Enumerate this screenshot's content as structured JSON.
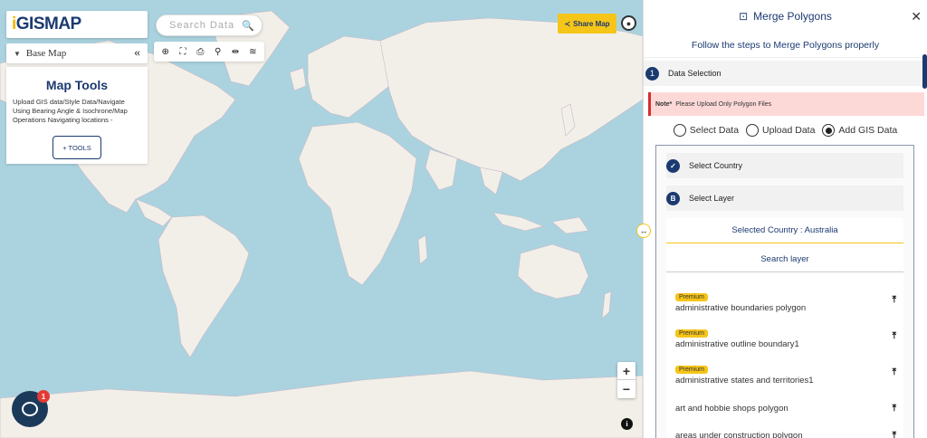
{
  "app": {
    "logo": "GISMAP",
    "basemap_label": "Base Map",
    "tools_title": "Map Tools",
    "tools_desc": "Upload GIS data/Style Data/Navigate Using Bearing Angle & Isochrone/Map Operations Navigating locations -",
    "tools_button": "+ TOOLS",
    "search_placeholder": "Search Data",
    "share_label": "Share Map",
    "chat_badge": "1"
  },
  "toolbar": {
    "icons": [
      "target-icon",
      "crop-icon",
      "print-icon",
      "zoom-search-icon",
      "measure-icon",
      "layers-icon"
    ]
  },
  "panel": {
    "title": "Merge Polygons",
    "subtitle": "Follow the steps to Merge Polygons properly",
    "step1_num": "1",
    "step1_label": "Data Selection",
    "note_prefix": "Note*",
    "note_text": "Please Upload Only Polygon Files",
    "radio_options": [
      "Select Data",
      "Upload Data",
      "Add GIS Data"
    ],
    "radio_selected": "Add GIS Data",
    "substep_a_label": "Select Country",
    "substep_b_icon": "B",
    "substep_b_label": "Select Layer",
    "selected_country": "Selected Country : Australia",
    "search_layer": "Search layer",
    "premium_label": "Premium",
    "layers": [
      {
        "name": "administrative boundaries polygon",
        "premium": true
      },
      {
        "name": "administrative outline boundary1",
        "premium": true
      },
      {
        "name": "administrative states and territories1",
        "premium": true
      },
      {
        "name": "art and hobbie shops polygon",
        "premium": false
      },
      {
        "name": "areas under construction polygon",
        "premium": false
      }
    ]
  },
  "colors": {
    "brand": "#1b3a70",
    "accent": "#f5c518",
    "ocean": "#aad3df",
    "land": "#f2efe9"
  }
}
